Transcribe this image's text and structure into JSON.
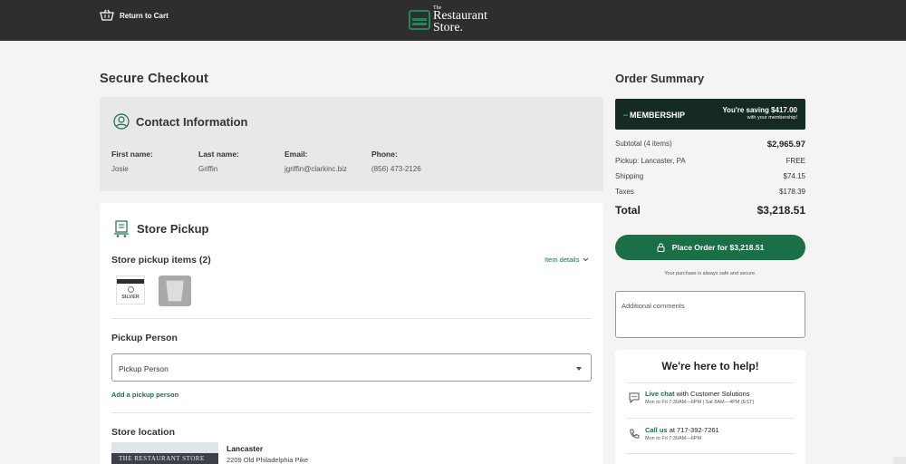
{
  "header": {
    "return_label": "Return to Cart",
    "logo_the": "The",
    "logo_line1": "Restaurant",
    "logo_line2": "Store."
  },
  "page_title": "Secure Checkout",
  "contact": {
    "title": "Contact Information",
    "fields": [
      {
        "label": "First name:",
        "value": "Josie"
      },
      {
        "label": "Last name:",
        "value": "Griffin"
      },
      {
        "label": "Email:",
        "value": "jgriffin@clarkinc.biz"
      },
      {
        "label": "Phone:",
        "value": "(856) 473-2126"
      }
    ]
  },
  "pickup": {
    "title": "Store Pickup",
    "items_heading": "Store pickup items (2)",
    "item_details_label": "Item details",
    "thumb1_label": "SILVER",
    "person_heading": "Pickup Person",
    "person_select_value": "Pickup Person",
    "add_person_label": "Add a pickup person",
    "location_heading": "Store location",
    "store_sign": "THE RESTAURANT STORE",
    "store_name": "Lancaster",
    "store_address": "2209 Old Philadelphia Pike"
  },
  "summary": {
    "title": "Order Summary",
    "membership_label": "MEMBERSHIP",
    "membership_savings": "You're saving $417.00",
    "membership_sub": "with your membership!",
    "subtotal_label": "Subtotal (4 items)",
    "subtotal_value": "$2,965.97",
    "pickup_label": "Pickup: Lancaster, PA",
    "pickup_value": "FREE",
    "shipping_label": "Shipping",
    "shipping_value": "$74.15",
    "taxes_label": "Taxes",
    "taxes_value": "$178.39",
    "total_label": "Total",
    "total_value": "$3,218.51",
    "place_order_label": "Place Order for $3,218.51",
    "safe_text": "Your purchase is always safe and secure.",
    "comments_placeholder": "Additional comments"
  },
  "help": {
    "title": "We're here to help!",
    "chat_link": "Live chat",
    "chat_rest": "with Customer Solutions",
    "chat_hours": "Mon to Fri 7:30AM—6PM | Sat 8AM—4PM (EST)",
    "call_link": "Call us",
    "call_rest": "at 717-392-7261",
    "call_hours": "Mon to Fri 7:30AM—6PM"
  },
  "colors": {
    "header_bg": "#2e2e2e",
    "accent_green": "#1b6f47",
    "membership_bg": "#152a20"
  }
}
